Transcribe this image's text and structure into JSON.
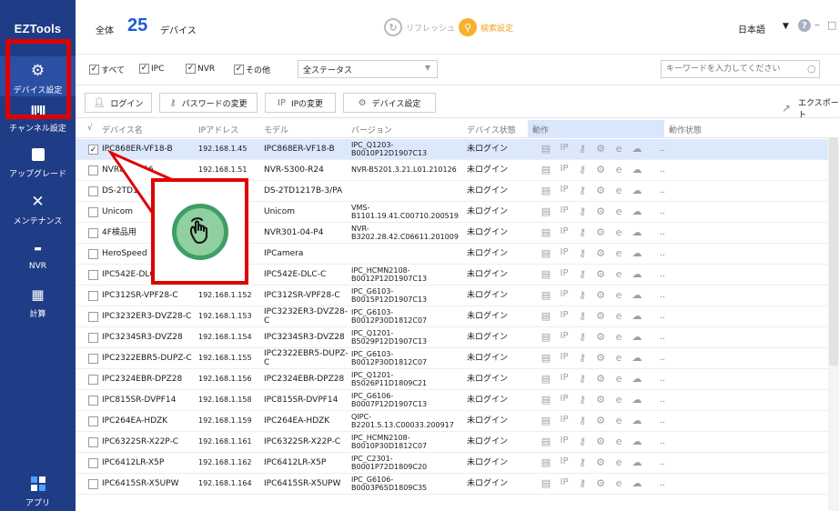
{
  "app": {
    "name": "EZTools"
  },
  "sidebar": {
    "items": [
      {
        "label": "デバイス設定",
        "icon": "gear-icon"
      },
      {
        "label": "チャンネル設定",
        "icon": "channel-icon"
      },
      {
        "label": "アップグレード",
        "icon": "upgrade-icon"
      },
      {
        "label": "メンテナンス",
        "icon": "wrench-icon"
      },
      {
        "label": "NVR",
        "icon": "nvr-icon"
      },
      {
        "label": "計算",
        "icon": "calculator-icon"
      },
      {
        "label": "アプリ",
        "icon": "apps-icon"
      }
    ]
  },
  "header": {
    "all_label": "全体",
    "count": "25",
    "unit": "デバイス",
    "refresh_label": "リフレッシュ",
    "search_settings_label": "検索設定",
    "language": "日本語"
  },
  "filters": {
    "all": "すべて",
    "ipc": "IPC",
    "nvr": "NVR",
    "other": "その他",
    "status_select": "全ステータス",
    "keyword_placeholder": "キーワードを入力してください"
  },
  "toolbar": {
    "login": "ログイン",
    "change_password": "パスワードの変更",
    "change_ip": "IPの変更",
    "device_settings": "デバイス設定",
    "export": "エクスポート"
  },
  "table": {
    "columns": {
      "check": "√",
      "name": "デバイス名",
      "ip": "IPアドレス",
      "model": "モデル",
      "version": "バージョン",
      "status": "デバイス状態",
      "action": "動作",
      "action_status": "動作状態"
    },
    "rows": [
      {
        "name": "IPC868ER-VF18-B",
        "ip": "192.168.1.45",
        "model": "IPC868ER-VF18-B",
        "version": "IPC_Q1203-B0010P12D1907C13",
        "status": "未ログイン",
        "checked": true
      },
      {
        "name": "NVR824-256",
        "ip": "192.168.1.51",
        "model": "NVR-S300-R24",
        "version": "NVR-B5201.3.21.L01.210126",
        "status": "未ログイン",
        "checked": false
      },
      {
        "name": "DS-2TD1217B-3/PA",
        "ip": "",
        "model": "DS-2TD1217B-3/PA",
        "version": "",
        "status": "未ログイン",
        "checked": false
      },
      {
        "name": "Unicom",
        "ip": "",
        "model": "Unicom",
        "version": "VMS-\nB1101.19.41.C00710.200519",
        "status": "未ログイン",
        "checked": false
      },
      {
        "name": "4F検品用",
        "ip": "",
        "model": "NVR301-04-P4",
        "version": "NVR-\nB3202.28.42.C06611.201009",
        "status": "未ログイン",
        "checked": false
      },
      {
        "name": "HeroSpeed",
        "ip": "",
        "model": "IPCamera",
        "version": "",
        "status": "未ログイン",
        "checked": false
      },
      {
        "name": "IPC542E-DLC-C",
        "ip": "",
        "model": "IPC542E-DLC-C",
        "version": "IPC_HCMN2108-\nB0012P12D1907C13",
        "status": "未ログイン",
        "checked": false
      },
      {
        "name": "IPC312SR-VPF28-C",
        "ip": "192.168.1.152",
        "model": "IPC312SR-VPF28-C",
        "version": "IPC_G6103-B0015P12D1907C13",
        "status": "未ログイン",
        "checked": false
      },
      {
        "name": "IPC3232ER3-DVZ28-C",
        "ip": "192.168.1.153",
        "model": "IPC3232ER3-DVZ28-C",
        "version": "IPC_G6103-B0012P30D1812C07",
        "status": "未ログイン",
        "checked": false
      },
      {
        "name": "IPC3234SR3-DVZ28",
        "ip": "192.168.1.154",
        "model": "IPC3234SR3-DVZ28",
        "version": "IPC_Q1201-B5029P12D1907C13",
        "status": "未ログイン",
        "checked": false
      },
      {
        "name": "IPC2322EBR5-DUPZ-C",
        "ip": "192.168.1.155",
        "model": "IPC2322EBR5-DUPZ-C",
        "version": "IPC_G6103-B0012P30D1812C07",
        "status": "未ログイン",
        "checked": false
      },
      {
        "name": "IPC2324EBR-DPZ28",
        "ip": "192.168.1.156",
        "model": "IPC2324EBR-DPZ28",
        "version": "IPC_Q1201-B5026P11D1809C21",
        "status": "未ログイン",
        "checked": false
      },
      {
        "name": "IPC815SR-DVPF14",
        "ip": "192.168.1.158",
        "model": "IPC815SR-DVPF14",
        "version": "IPC_G6106-B0007P12D1907C13",
        "status": "未ログイン",
        "checked": false
      },
      {
        "name": "IPC264EA-HDZK",
        "ip": "192.168.1.159",
        "model": "IPC264EA-HDZK",
        "version": "QIPC-\nB2201.5.13.C00033.200917",
        "status": "未ログイン",
        "checked": false
      },
      {
        "name": "IPC6322SR-X22P-C",
        "ip": "192.168.1.161",
        "model": "IPC6322SR-X22P-C",
        "version": "IPC_HCMN2108-\nB0010P30D1812C07",
        "status": "未ログイン",
        "checked": false
      },
      {
        "name": "IPC6412LR-X5P",
        "ip": "192.168.1.162",
        "model": "IPC6412LR-X5P",
        "version": "IPC_C2301-B0001P72D1809C20",
        "status": "未ログイン",
        "checked": false
      },
      {
        "name": "IPC6415SR-X5UPW",
        "ip": "192.168.1.164",
        "model": "IPC6415SR-X5UPW",
        "version": "IPC_G6106-B0003P65D1809C35",
        "status": "未ログイン",
        "checked": false
      }
    ]
  },
  "row_actions": {
    "icons": [
      "document-icon",
      "ip-icon",
      "key-icon",
      "gear-icon",
      "browser-icon",
      "cloud-icon"
    ],
    "ip_text": "IP",
    "more": ".."
  },
  "colors": {
    "sidebar": "#1f3d86",
    "accent": "#1f5bd6",
    "highlight": "#e00000",
    "selected_row": "#dce8fc"
  }
}
